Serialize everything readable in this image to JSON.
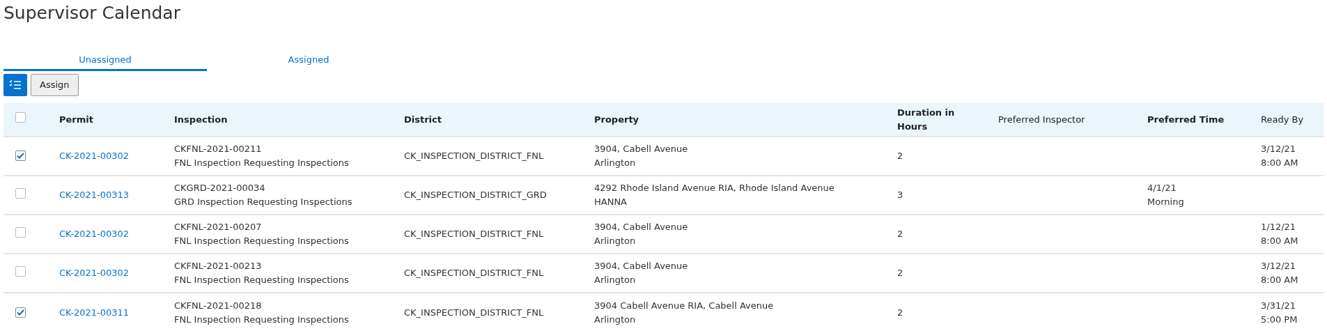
{
  "page_title": "Supervisor Calendar",
  "tabs": [
    {
      "label": "Unassigned",
      "selected": true
    },
    {
      "label": "Assigned",
      "selected": false
    }
  ],
  "toolbar": {
    "assign_button": "Assign"
  },
  "table": {
    "select_all_checked": false,
    "columns": [
      {
        "label": "Permit",
        "bold": true
      },
      {
        "label": "Inspection",
        "bold": true
      },
      {
        "label": "District",
        "bold": true
      },
      {
        "label": "Property",
        "bold": true
      },
      {
        "label": "Duration in Hours",
        "bold": true
      },
      {
        "label": "Preferred Inspector",
        "bold": false
      },
      {
        "label": "Preferred Time",
        "bold": true
      },
      {
        "label": "Ready By",
        "bold": false
      }
    ],
    "rows": [
      {
        "checked": true,
        "permit": "CK-2021-00302",
        "inspection": [
          "CKFNL-2021-00211",
          "FNL Inspection Requesting Inspections"
        ],
        "district": "CK_INSPECTION_DISTRICT_FNL",
        "property": [
          "3904, Cabell Avenue",
          "Arlington"
        ],
        "duration": "2",
        "ready_by": [
          "3/12/21",
          "8:00 AM"
        ]
      },
      {
        "checked": false,
        "permit": "CK-2021-00313",
        "inspection": [
          "CKGRD-2021-00034",
          "GRD Inspection Requesting Inspections"
        ],
        "district": "CK_INSPECTION_DISTRICT_GRD",
        "property": [
          "4292 Rhode Island Avenue RIA, Rhode Island Avenue",
          "HANNA"
        ],
        "duration": "3",
        "preferred_time": [
          "4/1/21",
          "Morning"
        ]
      },
      {
        "checked": false,
        "permit": "CK-2021-00302",
        "inspection": [
          "CKFNL-2021-00207",
          "FNL Inspection Requesting Inspections"
        ],
        "district": "CK_INSPECTION_DISTRICT_FNL",
        "property": [
          "3904, Cabell Avenue",
          "Arlington"
        ],
        "duration": "2",
        "ready_by": [
          "1/12/21",
          "8:00 AM"
        ]
      },
      {
        "checked": false,
        "permit": "CK-2021-00302",
        "inspection": [
          "CKFNL-2021-00213",
          "FNL Inspection Requesting Inspections"
        ],
        "district": "CK_INSPECTION_DISTRICT_FNL",
        "property": [
          "3904, Cabell Avenue",
          "Arlington"
        ],
        "duration": "2",
        "ready_by": [
          "3/12/21",
          "8:00 AM"
        ]
      },
      {
        "checked": true,
        "permit": "CK-2021-00311",
        "inspection": [
          "CKFNL-2021-00218",
          "FNL Inspection Requesting Inspections"
        ],
        "district": "CK_INSPECTION_DISTRICT_FNL",
        "property": [
          "3904 Cabell Avenue RIA, Cabell Avenue",
          "Arlington"
        ],
        "duration": "2",
        "ready_by": [
          "3/31/21",
          "5:00 PM"
        ]
      }
    ]
  }
}
